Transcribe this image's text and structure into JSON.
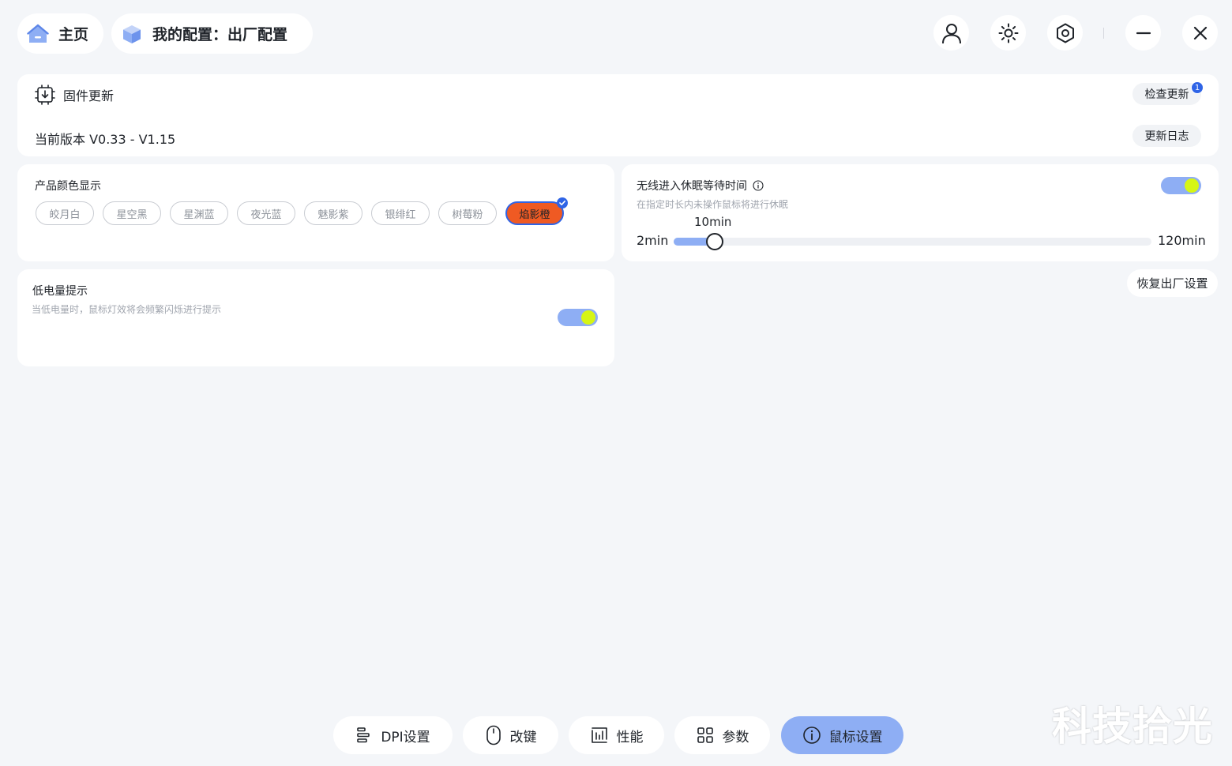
{
  "header": {
    "home_label": "主页",
    "profile_label": "我的配置：出厂配置"
  },
  "firmware": {
    "title": "固件更新",
    "version_label": "当前版本 V0.33 - V1.15",
    "check_button": "检查更新",
    "badge_count": "1",
    "log_button": "更新日志"
  },
  "color_display": {
    "title": "产品颜色显示",
    "options": [
      "皎月白",
      "星空黑",
      "星渊蓝",
      "夜光蓝",
      "魅影紫",
      "银绯红",
      "树莓粉",
      "焰影橙"
    ],
    "selected": "焰影橙",
    "selected_color": "#ef5a23"
  },
  "sleep": {
    "title": "无线进入休眠等待时间",
    "description": "在指定时长内未操作鼠标将进行休眠",
    "min_label": "2min",
    "max_label": "120min",
    "value_label": "10min",
    "min": 2,
    "max": 120,
    "value": 10,
    "enabled": true
  },
  "battery": {
    "title": "低电量提示",
    "description": "当低电量时，鼠标灯效将会频繁闪烁进行提示",
    "enabled": true
  },
  "reset_button": "恢复出厂设置",
  "bottom_nav": {
    "items": [
      {
        "label": "DPI设置",
        "icon": "dpi-bars-icon"
      },
      {
        "label": "改键",
        "icon": "mouse-icon"
      },
      {
        "label": "性能",
        "icon": "performance-chart-icon"
      },
      {
        "label": "参数",
        "icon": "grid-icon"
      },
      {
        "label": "鼠标设置",
        "icon": "info-circle-icon"
      }
    ],
    "active": "鼠标设置"
  },
  "watermark": "科技拾光",
  "colors": {
    "accent": "#8eaef4",
    "toggle_knob": "#d6f515",
    "badge": "#2f64e6"
  }
}
